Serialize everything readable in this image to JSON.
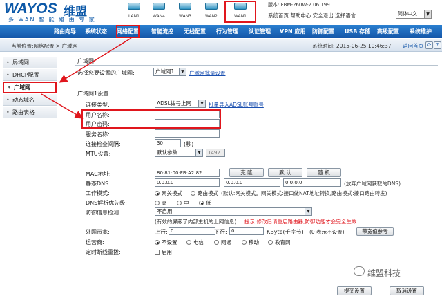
{
  "header": {
    "brand": "WAYOS",
    "brand_cn": "维盟",
    "slogan": "多 WAN 智 能 路 由 专 家",
    "ports": [
      "LAN1",
      "WAN4",
      "WAN3",
      "WAN2",
      "WAN1"
    ],
    "version": "版本: FBM-260W-2.06.199",
    "links": "系统首页 帮助中心 安全退出 选择语言:",
    "language": "简体中文"
  },
  "nav": [
    "路由向导",
    "系统状态",
    "网络配置",
    "智能流控",
    "无线配置",
    "行为管理",
    "认证管理",
    "VPN 应用",
    "防御配置",
    "USB 存储",
    "高级配置",
    "系统维护"
  ],
  "breadcrumb": "当前位置:网络配置 > 广域网",
  "system_time": "系统时间: 2015-06-25 10:46:37",
  "back": "返回首页",
  "sidebar": [
    "局域网",
    "DHCP配置",
    "广域网",
    "动态域名",
    "路由表格"
  ],
  "content": {
    "section1": "广域网",
    "select_wan_label": "选择您要设置的广域网:",
    "select_wan_value": "广域网1",
    "batch_link": "广域网批量设置",
    "section2": "广域网1设置",
    "conn_type_label": "连接类型:",
    "conn_type_value": "ADSL拨号上网",
    "import_link": "批量导入ADSL账号账号",
    "username_label": "用户名称:",
    "password_label": "用户密码:",
    "service_label": "服务名称:",
    "interval_label": "连接检查间隔:",
    "interval_value": "30",
    "interval_unit": "(秒)",
    "mtu_label": "MTU设置:",
    "mtu_value": "默认参数",
    "mtu_num": "1492",
    "mac_label": "MAC地址:",
    "mac_value": "80:81:00:FB:A2:82",
    "btn_clone": "克 隆",
    "btn_default": "默 认",
    "btn_random": "随 机",
    "dns_label": "静态DNS:",
    "dns1": "0.0.0.0",
    "dns2": "0.0.0.0",
    "dns3": "0.0.0.0",
    "dns_hint": "(放弃广域网获取的DNS)",
    "mode_label": "工作模式:",
    "mode_opt1": "网关模式",
    "mode_opt2": "路由模式",
    "mode_hint": "(默认:网关模式。网关模式:接口做NAT地址转换,路由模式:接口路由转发)",
    "dns_pri_label": "DNS解析优先级:",
    "pri_high": "高",
    "pri_mid": "中",
    "pri_low": "低",
    "defense_label": "防御信息检测:",
    "defense_value": "不启用",
    "defense_hint": "(有效的屏蔽了内部主机的上网信息)",
    "defense_warn": "提示:修改后请重启路由器,防御功能才会完全生效",
    "bandwidth_label": "外网带宽:",
    "up_label": "上行:",
    "up_value": "0",
    "down_label": "下行:",
    "down_value": "0",
    "bw_unit": "KByte(千字节)",
    "bw_hint": "(0 表示不设置)",
    "btn_bw_ref": "带宽值参考",
    "isp_label": "运营商:",
    "isp_opts": [
      "不设置",
      "电信",
      "网通",
      "移动",
      "教育网"
    ],
    "redial_label": "定时断线重拨:",
    "redial_opt": "启用",
    "btn_submit": "提交设置",
    "btn_cancel": "取消设置"
  },
  "watermark": "维盟科技"
}
